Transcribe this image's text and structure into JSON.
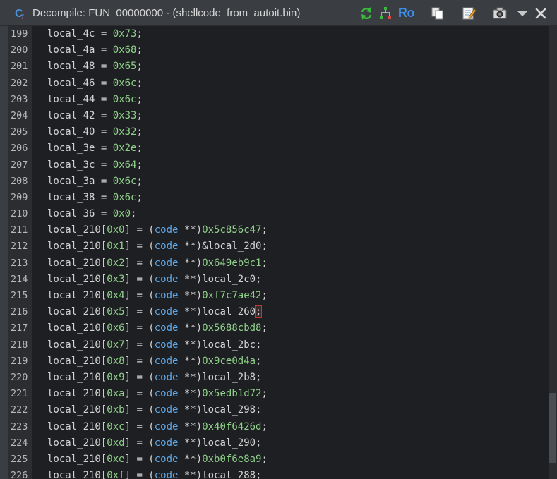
{
  "window": {
    "title_prefix": "Decompile: FUN_00000000",
    "title_sep": " - ",
    "title_file": "(shellcode_from_autoit.bin)",
    "toolbar": {
      "refresh_icon": "refresh-arrows-icon",
      "graph_icon": "function-graph-icon",
      "ro_label": "Ro",
      "copy_icon": "copy-icon",
      "edit_icon": "edit-notepad-icon",
      "snapshot_icon": "camera-snapshot-icon",
      "menu_icon": "dropdown-triangle-icon",
      "close_icon": "close-x-icon"
    }
  },
  "code_lines": [
    {
      "ln": "199",
      "lhs": "local_4c",
      "rhs": "0x73"
    },
    {
      "ln": "200",
      "lhs": "local_4a",
      "rhs": "0x68"
    },
    {
      "ln": "201",
      "lhs": "local_48",
      "rhs": "0x65"
    },
    {
      "ln": "202",
      "lhs": "local_46",
      "rhs": "0x6c"
    },
    {
      "ln": "203",
      "lhs": "local_44",
      "rhs": "0x6c"
    },
    {
      "ln": "204",
      "lhs": "local_42",
      "rhs": "0x33"
    },
    {
      "ln": "205",
      "lhs": "local_40",
      "rhs": "0x32"
    },
    {
      "ln": "206",
      "lhs": "local_3e",
      "rhs": "0x2e"
    },
    {
      "ln": "207",
      "lhs": "local_3c",
      "rhs": "0x64"
    },
    {
      "ln": "208",
      "lhs": "local_3a",
      "rhs": "0x6c"
    },
    {
      "ln": "209",
      "lhs": "local_38",
      "rhs": "0x6c"
    },
    {
      "ln": "210",
      "lhs": "local_36",
      "rhs": "0x0"
    }
  ],
  "cast_lines": [
    {
      "ln": "211",
      "idx": "0x0",
      "val": "0x5c856c47",
      "val_kind": "num"
    },
    {
      "ln": "212",
      "idx": "0x1",
      "val": "&local_2d0",
      "val_kind": "var"
    },
    {
      "ln": "213",
      "idx": "0x2",
      "val": "0x649eb9c1",
      "val_kind": "num"
    },
    {
      "ln": "214",
      "idx": "0x3",
      "val": "local_2c0",
      "val_kind": "var"
    },
    {
      "ln": "215",
      "idx": "0x4",
      "val": "0xf7c7ae42",
      "val_kind": "num"
    },
    {
      "ln": "216",
      "idx": "0x5",
      "val": "local_260",
      "val_kind": "var",
      "cursor": true
    },
    {
      "ln": "217",
      "idx": "0x6",
      "val": "0x5688cbd8",
      "val_kind": "num"
    },
    {
      "ln": "218",
      "idx": "0x7",
      "val": "local_2bc",
      "val_kind": "var"
    },
    {
      "ln": "219",
      "idx": "0x8",
      "val": "0x9ce0d4a",
      "val_kind": "num"
    },
    {
      "ln": "220",
      "idx": "0x9",
      "val": "local_2b8",
      "val_kind": "var"
    },
    {
      "ln": "221",
      "idx": "0xa",
      "val": "0x5edb1d72",
      "val_kind": "num"
    },
    {
      "ln": "222",
      "idx": "0xb",
      "val": "local_298",
      "val_kind": "var"
    },
    {
      "ln": "223",
      "idx": "0xc",
      "val": "0x40f6426d",
      "val_kind": "num"
    },
    {
      "ln": "224",
      "idx": "0xd",
      "val": "local_290",
      "val_kind": "var"
    },
    {
      "ln": "225",
      "idx": "0xe",
      "val": "0xb0f6e8a9",
      "val_kind": "num"
    },
    {
      "ln": "226",
      "idx": "0xf",
      "val": "local_288",
      "val_kind": "var"
    }
  ],
  "cast_array": "local_210",
  "cast_type": "code",
  "cast_ptr": "**",
  "colors": {
    "background": "#1e1f22",
    "titlebar": "#3a3d41",
    "number": "#8fd18a",
    "type_keyword": "#5fa8e8",
    "text": "#d4d4d4",
    "line_number": "#b8b8b8",
    "ro_accent": "#3d8ee8"
  }
}
